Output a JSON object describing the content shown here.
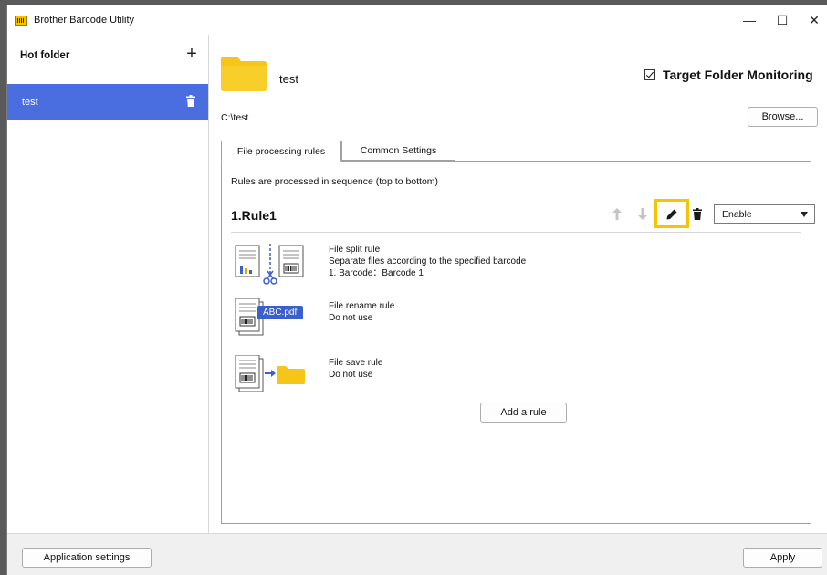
{
  "window": {
    "title": "Brother Barcode Utility",
    "controls": {
      "minimize": "—",
      "maximize": "☐",
      "close": "✕"
    }
  },
  "sidebar": {
    "heading": "Hot folder",
    "add_symbol": "+",
    "items": [
      {
        "label": "test",
        "selected": true
      }
    ]
  },
  "folder": {
    "name": "test",
    "path": "C:\\test",
    "browse_label": "Browse...",
    "monitoring_label": "Target Folder Monitoring",
    "monitoring_checked": true
  },
  "tabs": [
    {
      "label": "File processing rules",
      "active": true
    },
    {
      "label": "Common Settings",
      "active": false
    }
  ],
  "rules_panel": {
    "note": "Rules are processed in sequence (top to bottom)",
    "rule": {
      "title": "1.Rule1",
      "status_options_selected": "Enable",
      "actions": [
        "arrow-up-icon",
        "arrow-down-icon",
        "pencil-icon",
        "trash-icon"
      ],
      "split": {
        "title": "File split rule",
        "description": "Separate files according to the specified barcode",
        "detail": "1. Barcode：Barcode 1"
      },
      "rename": {
        "title": "File rename rule",
        "description": "Do not use",
        "badge": "ABC.pdf"
      },
      "save": {
        "title": "File save rule",
        "description": "Do not use"
      }
    },
    "add_rule_label": "Add a rule"
  },
  "footer": {
    "app_settings_label": "Application settings",
    "apply_label": "Apply"
  },
  "colors": {
    "accent": "#4a6ee0",
    "folder": "#f5c518",
    "highlight": "#f6c400"
  }
}
